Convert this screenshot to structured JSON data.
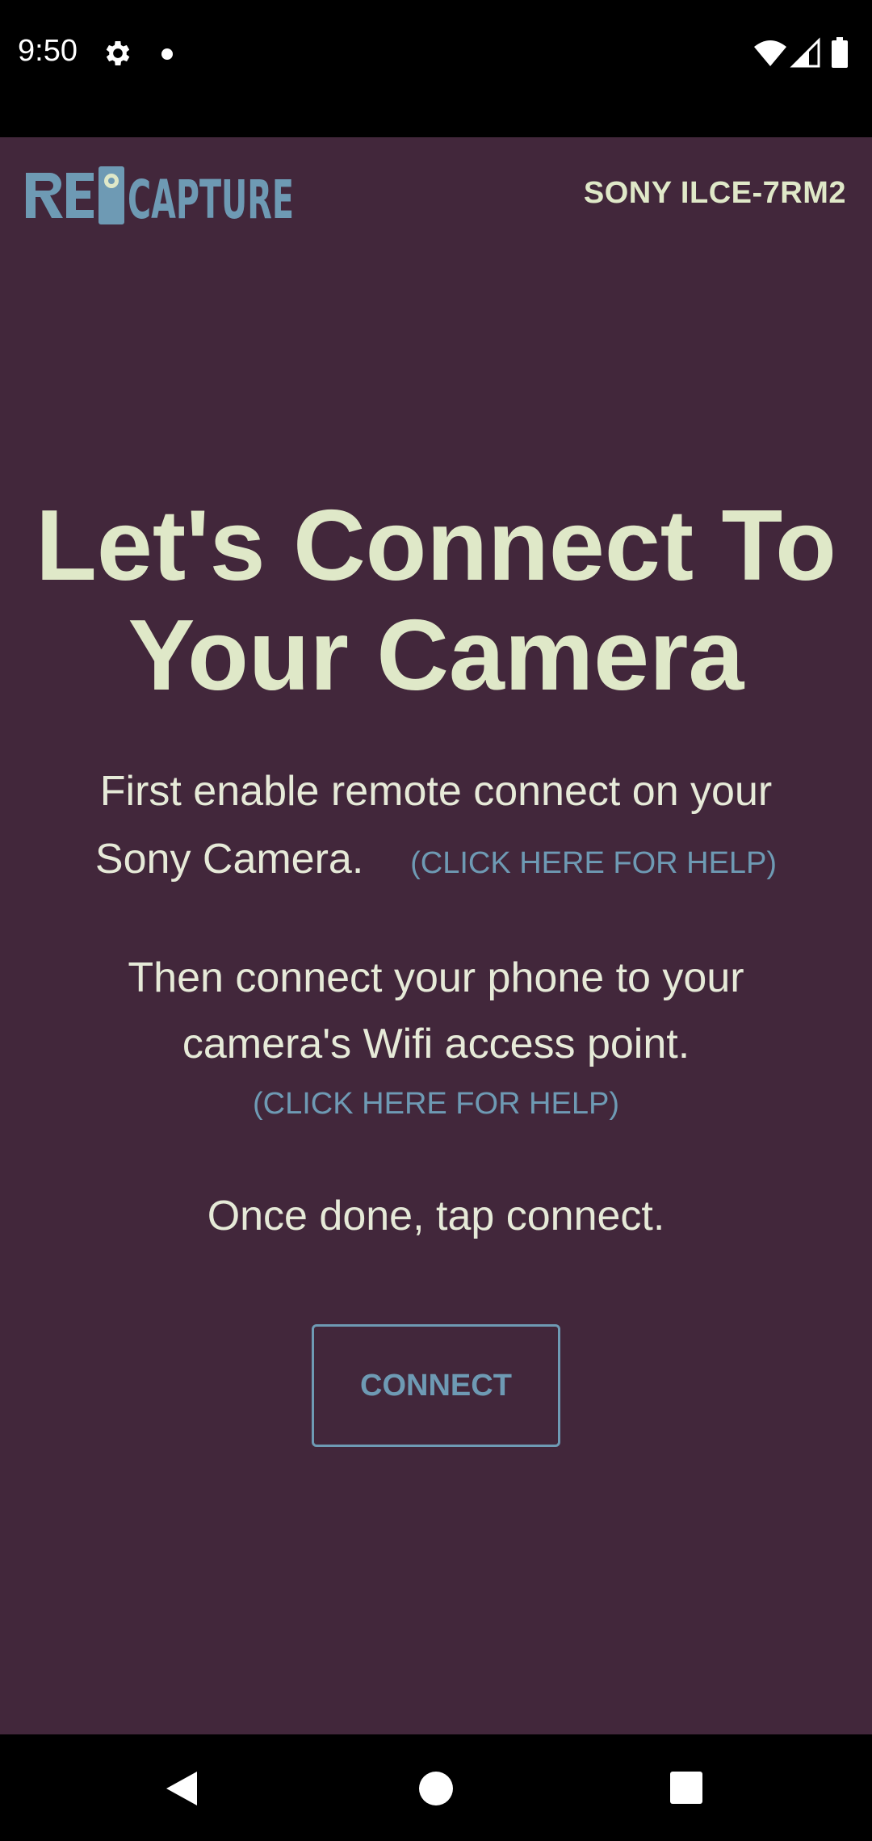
{
  "status_bar": {
    "time": "9:50"
  },
  "header": {
    "logo_text": "RE CAPTURE",
    "device_name": "SONY ILCE-7RM2"
  },
  "main": {
    "headline_line1": "Let's Connect To",
    "headline_line2": "Your Camera",
    "step1_text_line1": "First enable remote connect on your",
    "step1_text_line2": "Sony Camera.",
    "step1_help": "(CLICK HERE FOR HELP)",
    "step2_text_line1": "Then connect your phone to your",
    "step2_text_line2": "camera's Wifi access point.",
    "step2_help": "(CLICK HERE FOR HELP)",
    "step3_text": "Once done, tap connect.",
    "connect_label": "CONNECT"
  },
  "colors": {
    "background": "#42273b",
    "headline": "#dfe8c8",
    "accent": "#6e9ab4"
  },
  "icons": {
    "status_left": [
      "gear-icon",
      "notification-dot-icon"
    ],
    "status_right": [
      "wifi-icon",
      "cell-signal-icon",
      "battery-icon"
    ],
    "nav": [
      "back-icon",
      "home-icon",
      "recents-icon"
    ]
  }
}
